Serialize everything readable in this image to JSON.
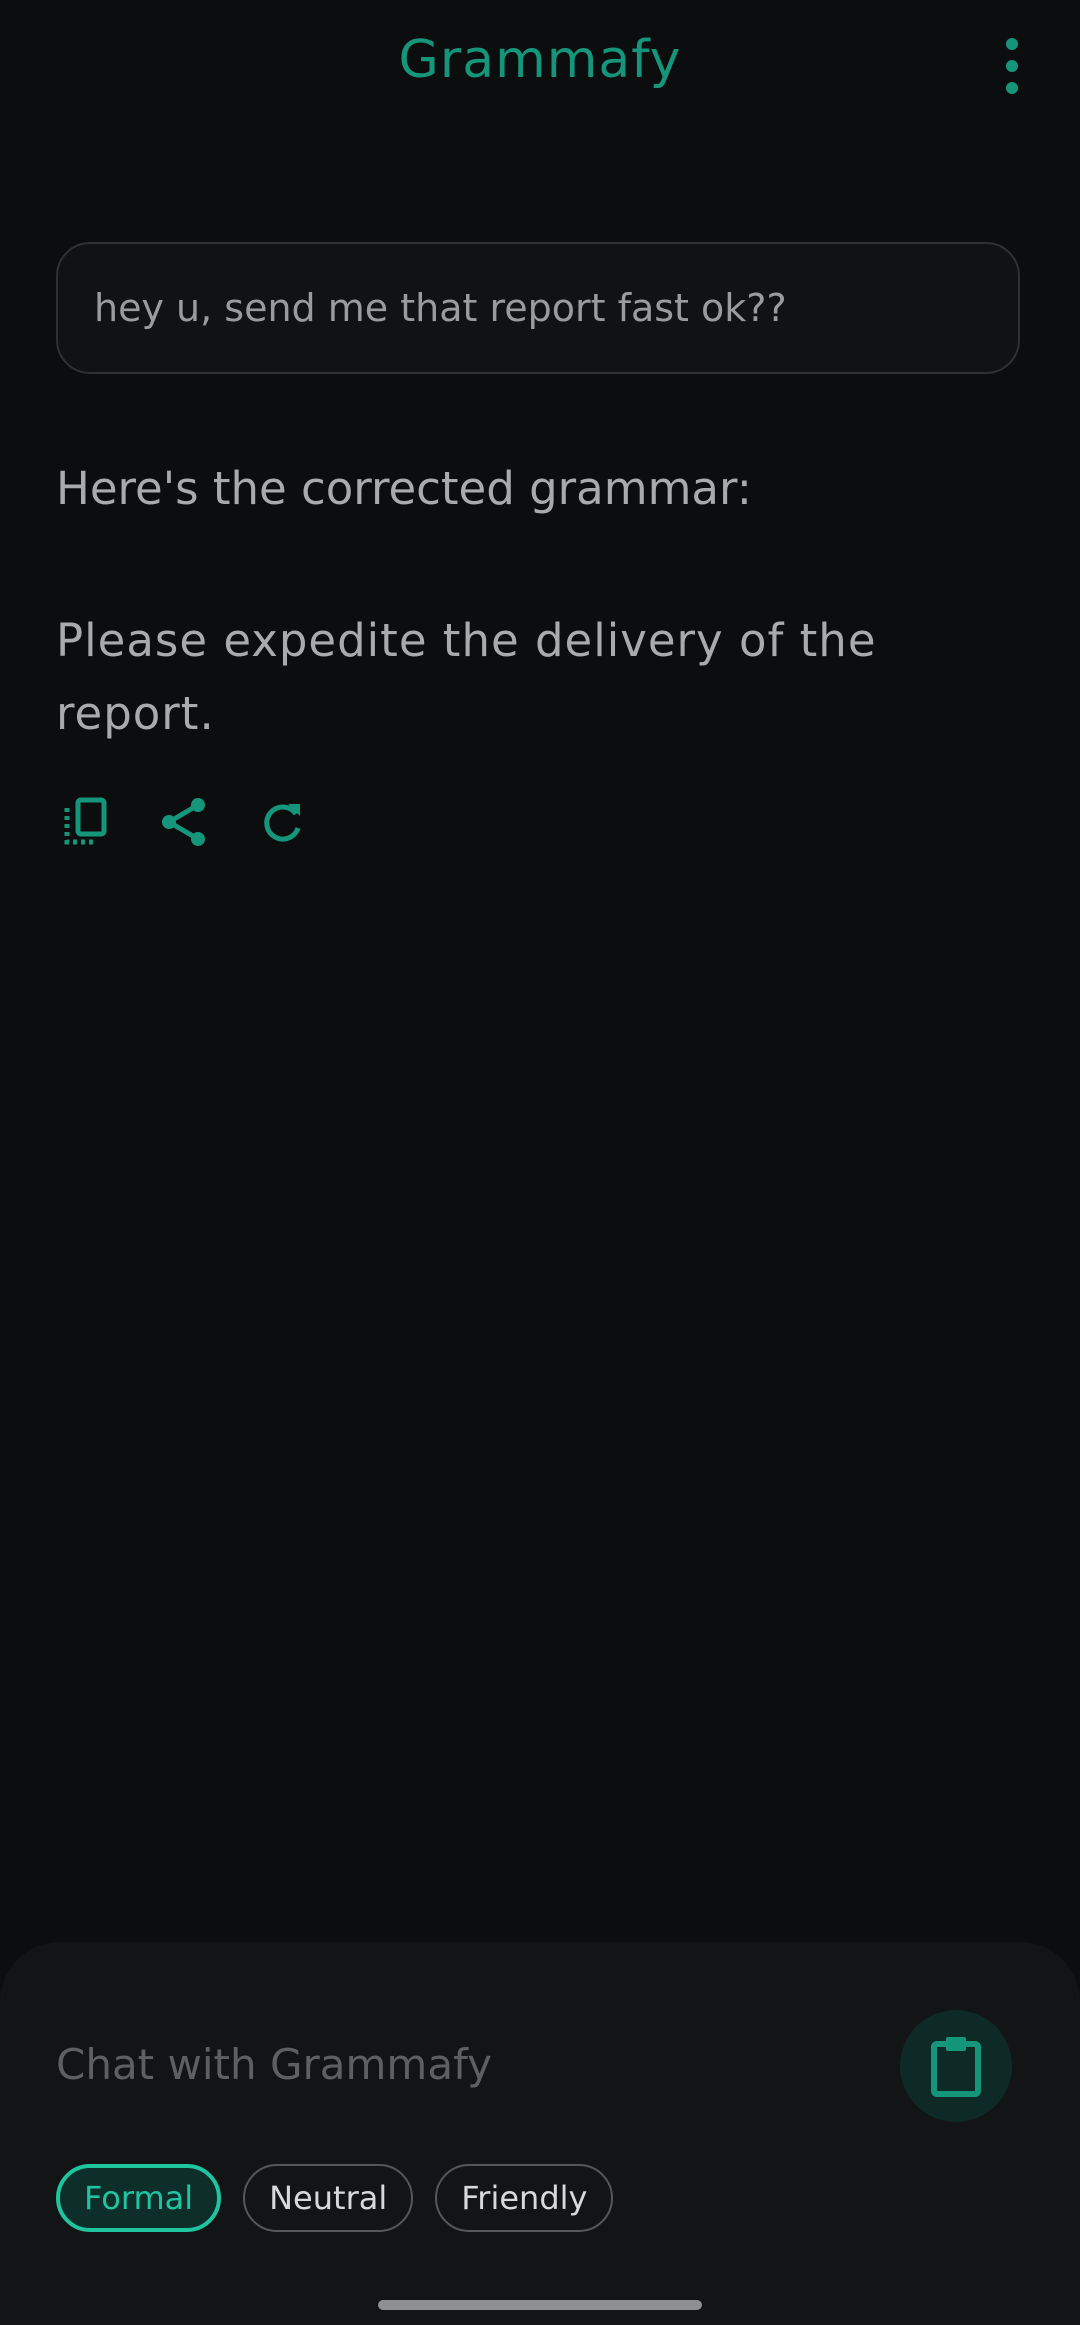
{
  "header": {
    "title": "Grammafy",
    "menu_icon": "more-vert-icon"
  },
  "input": {
    "value": "hey u, send me that report fast ok??"
  },
  "result": {
    "heading": "Here's the corrected grammar:",
    "text": "Please expedite the delivery of the report."
  },
  "actions": [
    {
      "icon": "copy-icon"
    },
    {
      "icon": "share-icon"
    },
    {
      "icon": "refresh-icon"
    }
  ],
  "chat": {
    "placeholder": "Chat with Grammafy",
    "fab_icon": "clipboard-icon"
  },
  "tones": {
    "items": [
      "Formal",
      "Neutral",
      "Friendly"
    ],
    "selected": "Formal"
  },
  "colors": {
    "accent": "#15967a",
    "chip_selected": "#1ec59f",
    "background": "#0c0d0f"
  }
}
